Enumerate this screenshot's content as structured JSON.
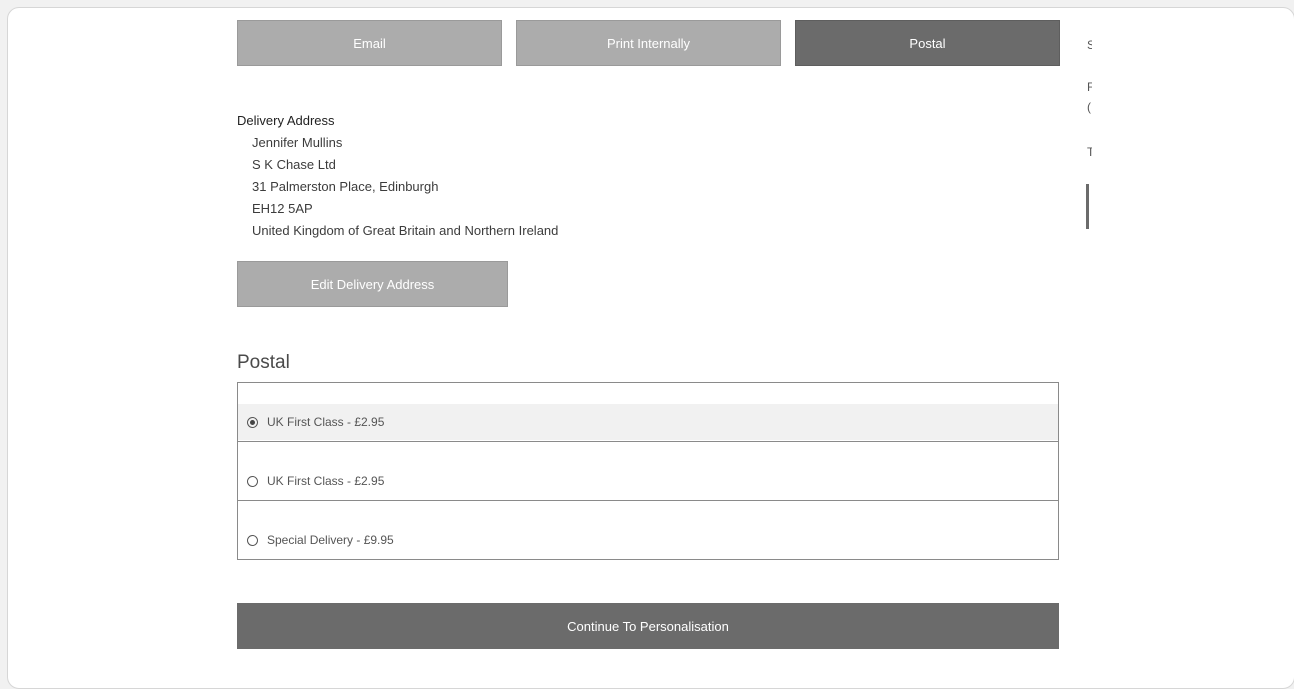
{
  "tabs": [
    {
      "label": "Email",
      "state": "inactive"
    },
    {
      "label": "Print Internally",
      "state": "inactive"
    },
    {
      "label": "Postal",
      "state": "active"
    }
  ],
  "delivery": {
    "heading": "Delivery Address",
    "lines": [
      "Jennifer Mullins",
      "S K Chase Ltd",
      "31 Palmerston Place, Edinburgh",
      "EH12 5AP",
      "United Kingdom of Great Britain and Northern Ireland"
    ],
    "edit_label": "Edit Delivery Address"
  },
  "postal": {
    "title": "Postal",
    "options": [
      {
        "label": "UK First Class - £2.95",
        "selected": true
      },
      {
        "label": "UK First Class - £2.95",
        "selected": false
      },
      {
        "label": "Special Delivery - £9.95",
        "selected": false
      }
    ]
  },
  "continue_label": "Continue To Personalisation",
  "sidebar_fragments": [
    "S",
    "F",
    "(",
    "T"
  ],
  "colors": {
    "inactive_button": "#acacac",
    "active_button": "#6b6b6b"
  }
}
